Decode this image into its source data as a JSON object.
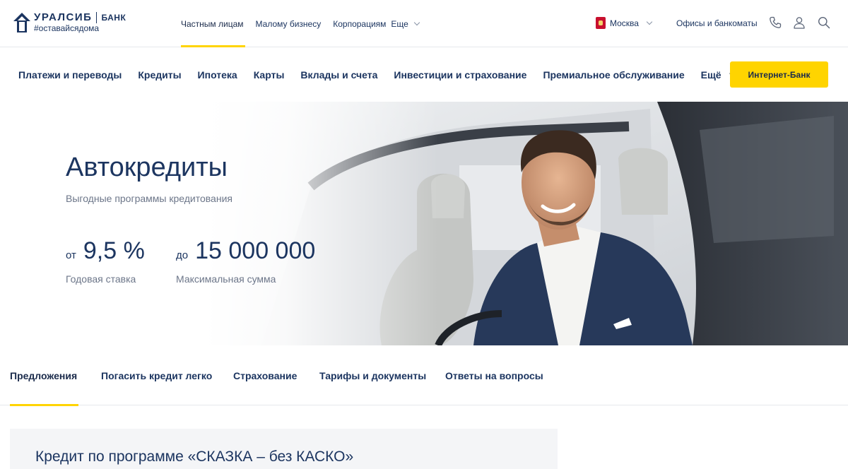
{
  "brand": {
    "name": "УРАЛСИБ",
    "bank": "БАНК",
    "tagline": "#оставайсядома",
    "color": "#1c3560"
  },
  "segments": {
    "items": [
      {
        "label": "Частным лицам",
        "active": true
      },
      {
        "label": "Малому бизнесу",
        "active": false
      },
      {
        "label": "Корпорациям",
        "active": false
      }
    ],
    "more_label": "Еще"
  },
  "topbar": {
    "city": "Москва",
    "offices_label": "Офисы и банкоматы",
    "icons": [
      "phone-icon",
      "user-icon",
      "search-icon"
    ]
  },
  "mainnav": {
    "items": [
      "Платежи и переводы",
      "Кредиты",
      "Ипотека",
      "Карты",
      "Вклады и счета",
      "Инвестиции и страхование",
      "Премиальное обслуживание"
    ],
    "more_label": "Ещё",
    "cta_label": "Интернет-Банк",
    "cta_color": "#ffd400"
  },
  "hero": {
    "title": "Автокредиты",
    "subtitle": "Выгодные программы кредитования",
    "rate": {
      "prefix": "от",
      "value": "9,5 %",
      "caption": "Годовая ставка"
    },
    "amount": {
      "prefix": "до",
      "value": "15 000 000",
      "caption": "Максимальная сумма"
    }
  },
  "tabs": {
    "items": [
      {
        "label": "Предложения",
        "active": true
      },
      {
        "label": "Погасить кредит легко",
        "active": false
      },
      {
        "label": "Страхование",
        "active": false
      },
      {
        "label": "Тарифы и документы",
        "active": false
      },
      {
        "label": "Ответы на вопросы",
        "active": false
      }
    ]
  },
  "offer": {
    "title": "Кредит по программе «СКАЗКА – без КАСКО»"
  }
}
